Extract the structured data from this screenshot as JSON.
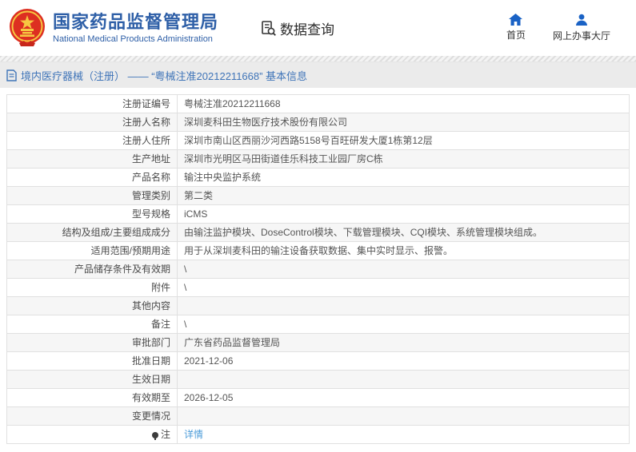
{
  "header": {
    "org_cn": "国家药品监督管理局",
    "org_en": "National Medical Products Administration",
    "nav_query": "数据查询",
    "home_label": "首页",
    "hall_label": "网上办事大厅"
  },
  "breadcrumb": {
    "text": "境内医疗器械（注册） —— “粤械注准20212211668” 基本信息"
  },
  "table": {
    "rows": [
      {
        "label": "注册证编号",
        "value": "粤械注准20212211668"
      },
      {
        "label": "注册人名称",
        "value": "深圳麦科田生物医疗技术股份有限公司"
      },
      {
        "label": "注册人住所",
        "value": "深圳市南山区西丽沙河西路5158号百旺研发大厦1栋第12层"
      },
      {
        "label": "生产地址",
        "value": "深圳市光明区马田街道佳乐科技工业园厂房C栋"
      },
      {
        "label": "产品名称",
        "value": "输注中央监护系统"
      },
      {
        "label": "管理类别",
        "value": "第二类"
      },
      {
        "label": "型号规格",
        "value": "iCMS"
      },
      {
        "label": "结构及组成/主要组成成分",
        "value": "由输注监护模块、DoseControl模块、下载管理模块、CQI模块、系统管理模块组成。"
      },
      {
        "label": "适用范围/预期用途",
        "value": "用于从深圳麦科田的输注设备获取数据、集中实时显示、报警。"
      },
      {
        "label": "产品储存条件及有效期",
        "value": "\\"
      },
      {
        "label": "附件",
        "value": "\\"
      },
      {
        "label": "其他内容",
        "value": ""
      },
      {
        "label": "备注",
        "value": "\\"
      },
      {
        "label": "审批部门",
        "value": "广东省药品监督管理局"
      },
      {
        "label": "批准日期",
        "value": "2021-12-06"
      },
      {
        "label": "生效日期",
        "value": ""
      },
      {
        "label": "有效期至",
        "value": "2026-12-05"
      },
      {
        "label": "变更情况",
        "value": ""
      },
      {
        "label": "注",
        "value": "详情",
        "value_is_link": true,
        "label_has_icon": true
      }
    ]
  },
  "colors": {
    "brand_blue": "#2e5fa7",
    "icon_blue": "#1a62c5",
    "breadcrumb_blue": "#3f74b8",
    "link_blue": "#4c9cd9",
    "emblem_red": "#dd2f21",
    "emblem_gold": "#f6c741",
    "titlebar_gray": "#ebebeb",
    "row_alt_gray": "#f6f6f6"
  }
}
